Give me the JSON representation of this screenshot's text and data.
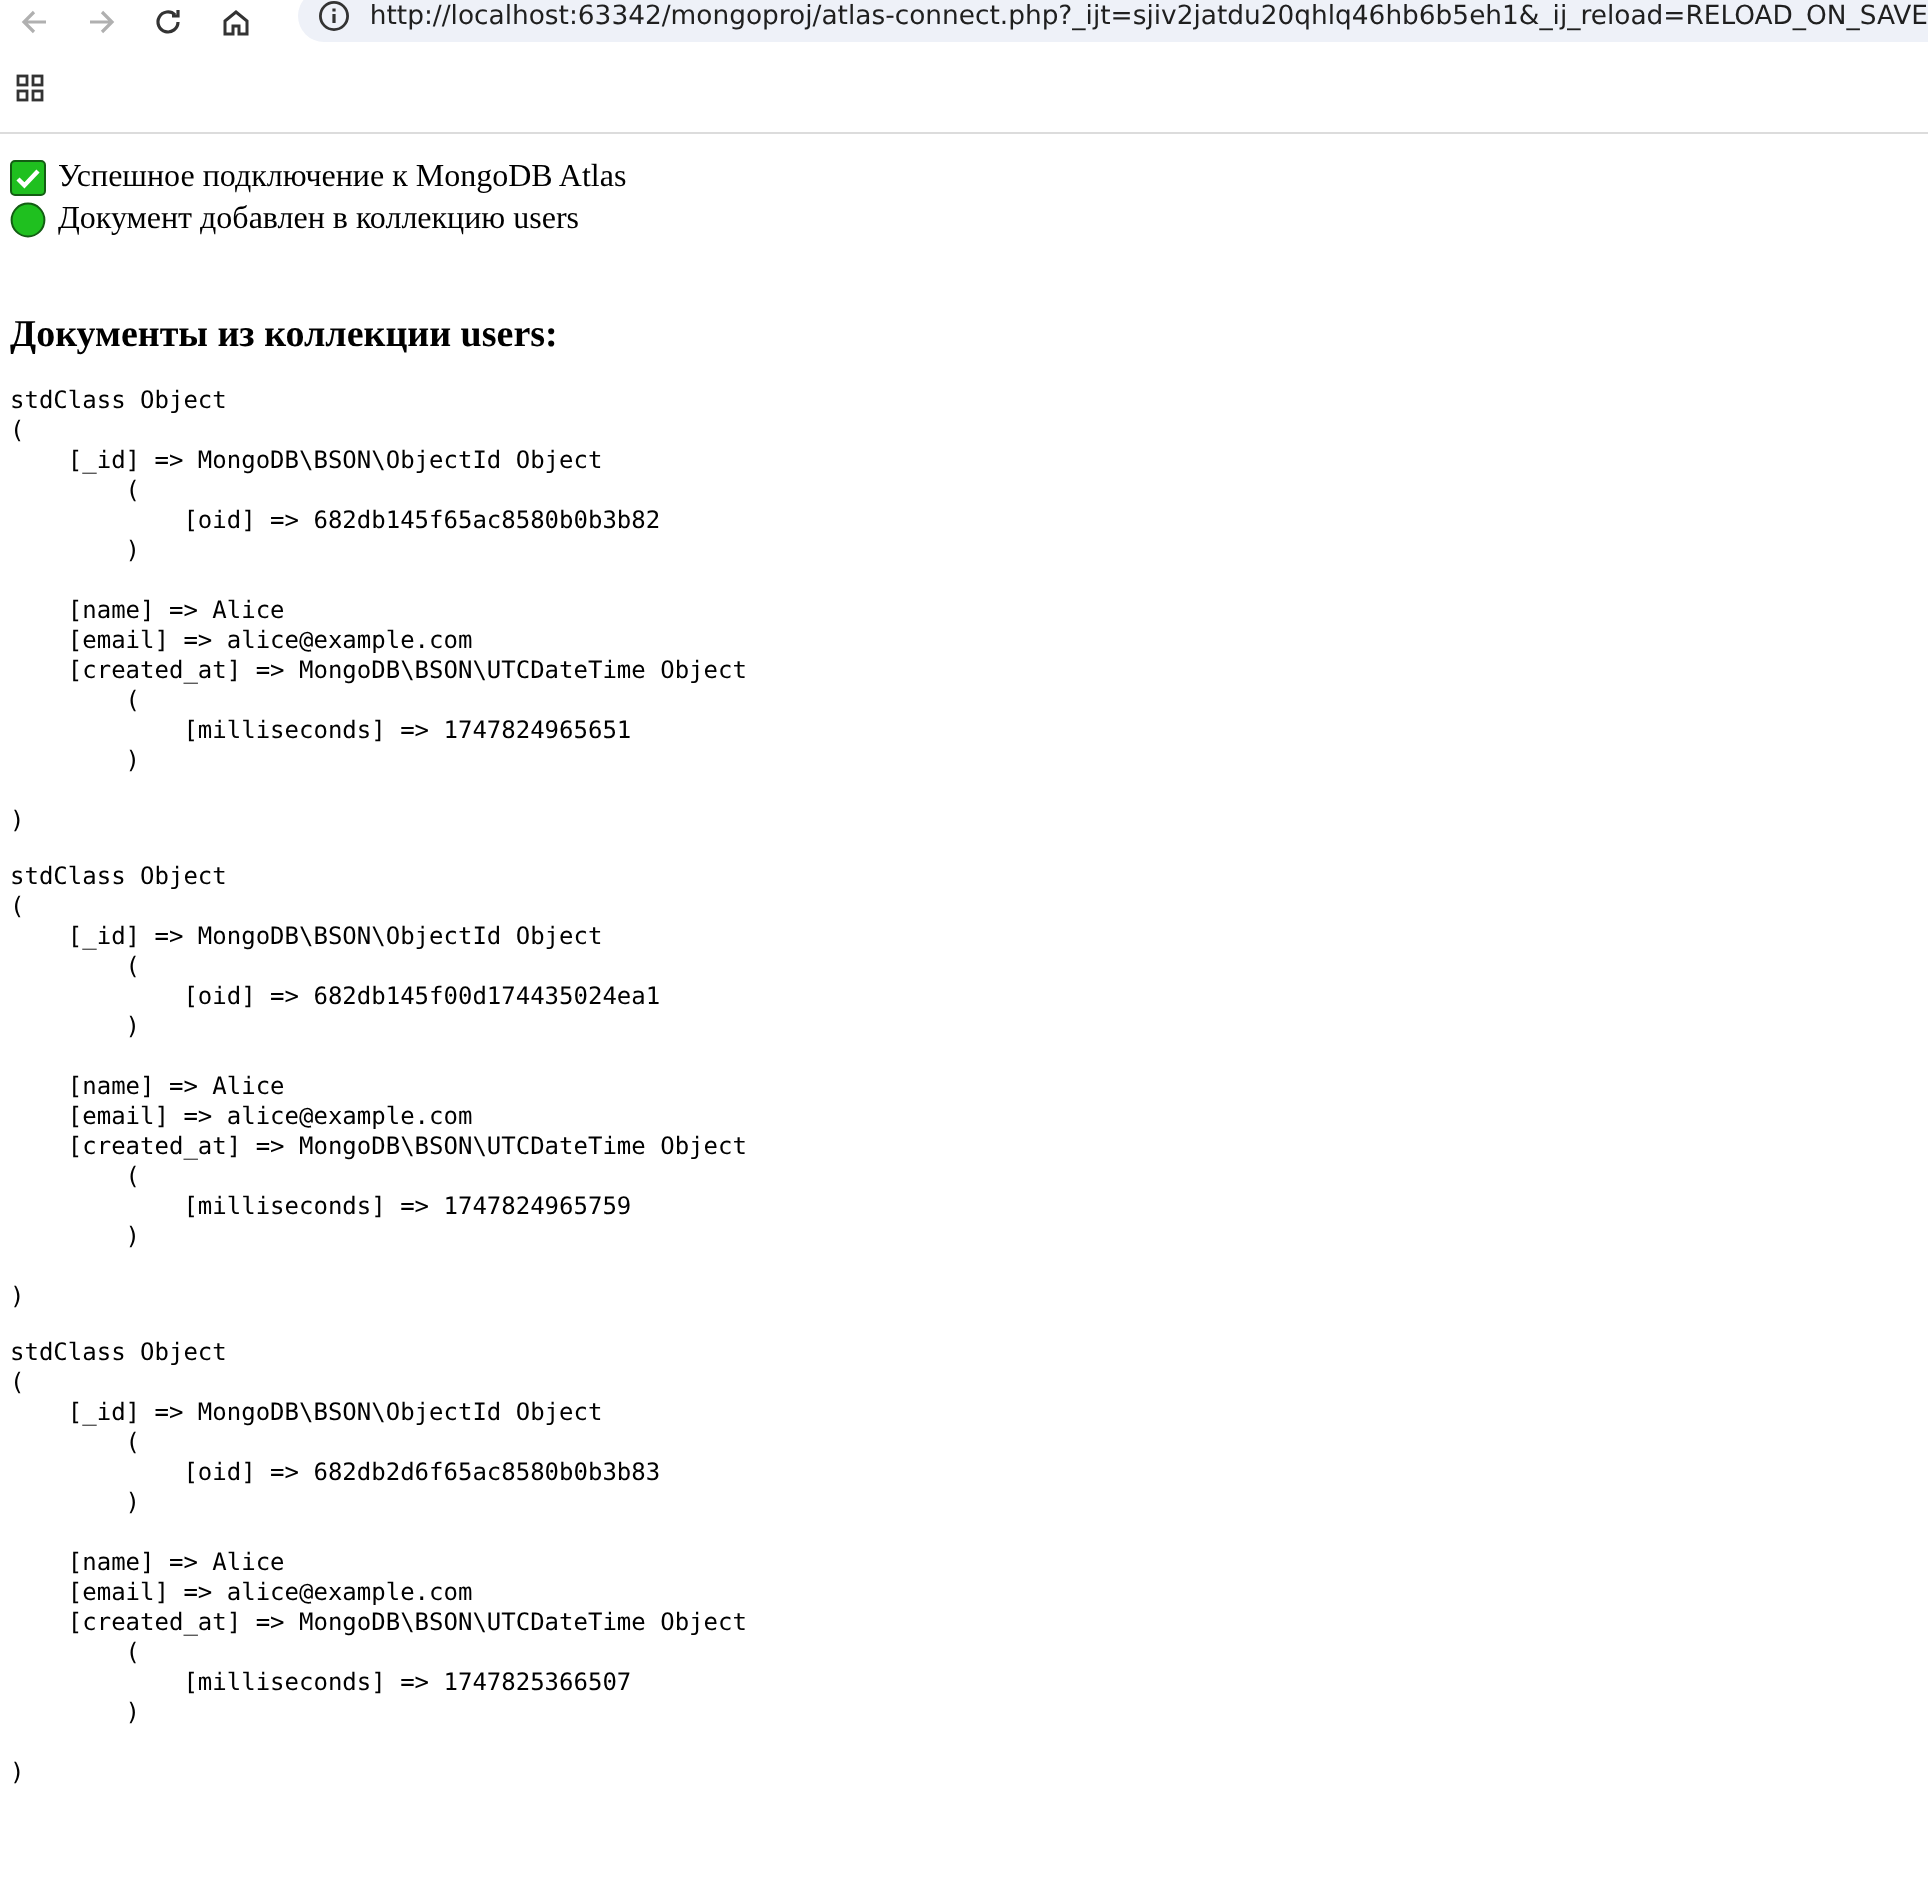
{
  "browser": {
    "url": "http://localhost:63342/mongoproj/atlas-connect.php?_ijt=sjiv2jatdu20qhlq46hb6b5eh1&_ij_reload=RELOAD_ON_SAVE"
  },
  "messages": [
    {
      "kind": "check",
      "text": "Успешное подключение к MongoDB Atlas"
    },
    {
      "kind": "dot",
      "text": "Документ добавлен в коллекцию users"
    }
  ],
  "heading": "Документы из коллекции users:",
  "documents": [
    {
      "text": "stdClass Object\n(\n    [_id] => MongoDB\\BSON\\ObjectId Object\n        (\n            [oid] => 682db145f65ac8580b0b3b82\n        )\n\n    [name] => Alice\n    [email] => alice@example.com\n    [created_at] => MongoDB\\BSON\\UTCDateTime Object\n        (\n            [milliseconds] => 1747824965651\n        )\n\n)"
    },
    {
      "text": "stdClass Object\n(\n    [_id] => MongoDB\\BSON\\ObjectId Object\n        (\n            [oid] => 682db145f00d174435024ea1\n        )\n\n    [name] => Alice\n    [email] => alice@example.com\n    [created_at] => MongoDB\\BSON\\UTCDateTime Object\n        (\n            [milliseconds] => 1747824965759\n        )\n\n)"
    },
    {
      "text": "stdClass Object\n(\n    [_id] => MongoDB\\BSON\\ObjectId Object\n        (\n            [oid] => 682db2d6f65ac8580b0b3b83\n        )\n\n    [name] => Alice\n    [email] => alice@example.com\n    [created_at] => MongoDB\\BSON\\UTCDateTime Object\n        (\n            [milliseconds] => 1747825366507\n        )\n\n)"
    }
  ]
}
